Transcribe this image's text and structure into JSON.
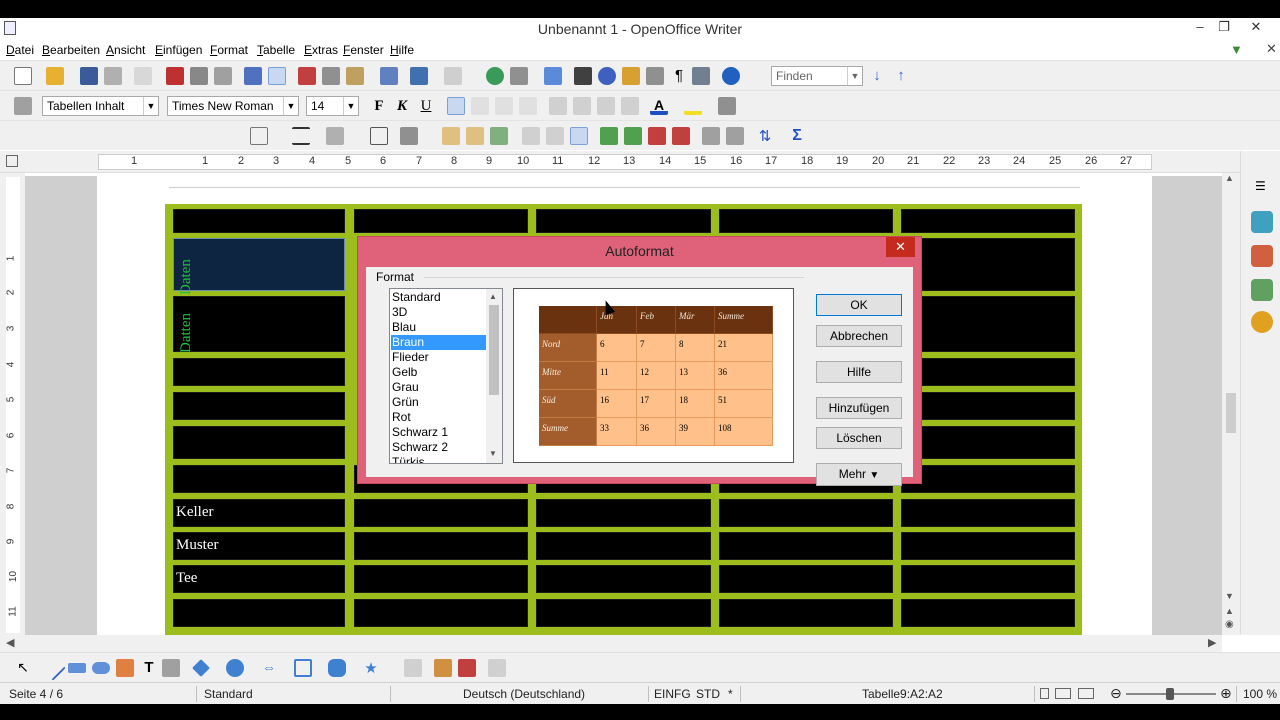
{
  "window": {
    "title": "Unbenannt 1 - OpenOffice Writer"
  },
  "menu": [
    "Datei",
    "Bearbeiten",
    "Ansicht",
    "Einfügen",
    "Format",
    "Tabelle",
    "Extras",
    "Fenster",
    "Hilfe"
  ],
  "toolbar": {
    "find_placeholder": "Finden"
  },
  "formatting": {
    "style": "Tabellen Inhalt",
    "font": "Times New Roman",
    "size": "14",
    "bold": "F",
    "italic": "K",
    "underline": "U"
  },
  "ruler": {
    "h_numbers": [
      "1",
      "1",
      "2",
      "3",
      "4",
      "5",
      "6",
      "7",
      "8",
      "9",
      "10",
      "11",
      "12",
      "13",
      "14",
      "15",
      "16",
      "17",
      "18",
      "19",
      "20",
      "21",
      "22",
      "23",
      "24",
      "25",
      "26",
      "27"
    ],
    "v_numbers": [
      "1",
      "2",
      "3",
      "4",
      "5",
      "6",
      "7",
      "8",
      "9",
      "10",
      "11"
    ]
  },
  "document": {
    "vertical_cells": [
      "Daten",
      "Datten"
    ],
    "row_labels": [
      "Keller",
      "Muster",
      "Tee"
    ]
  },
  "dialog": {
    "title": "Autoformat",
    "group_label": "Format",
    "formats": [
      "Standard",
      "3D",
      "Blau",
      "Braun",
      "Flieder",
      "Gelb",
      "Grau",
      "Grün",
      "Rot",
      "Schwarz 1",
      "Schwarz 2",
      "Türkis"
    ],
    "selected_format": "Braun",
    "buttons": {
      "ok": "OK",
      "cancel": "Abbrechen",
      "help": "Hilfe",
      "add": "Hinzufügen",
      "delete": "Löschen",
      "more": "Mehr"
    },
    "preview": {
      "header": [
        "",
        "Jan",
        "Feb",
        "Mär",
        "Summe"
      ],
      "rows": [
        [
          "Nord",
          "6",
          "7",
          "8",
          "21"
        ],
        [
          "Mitte",
          "11",
          "12",
          "13",
          "36"
        ],
        [
          "Süd",
          "16",
          "17",
          "18",
          "51"
        ],
        [
          "Summe",
          "33",
          "36",
          "39",
          "108"
        ]
      ]
    }
  },
  "status": {
    "page": "Seite 4 / 6",
    "style": "Standard",
    "language": "Deutsch (Deutschland)",
    "mode": "EINFG",
    "sel": "STD",
    "modified": "*",
    "cell": "Tabelle9:A2:A2",
    "zoom": "100 %"
  }
}
